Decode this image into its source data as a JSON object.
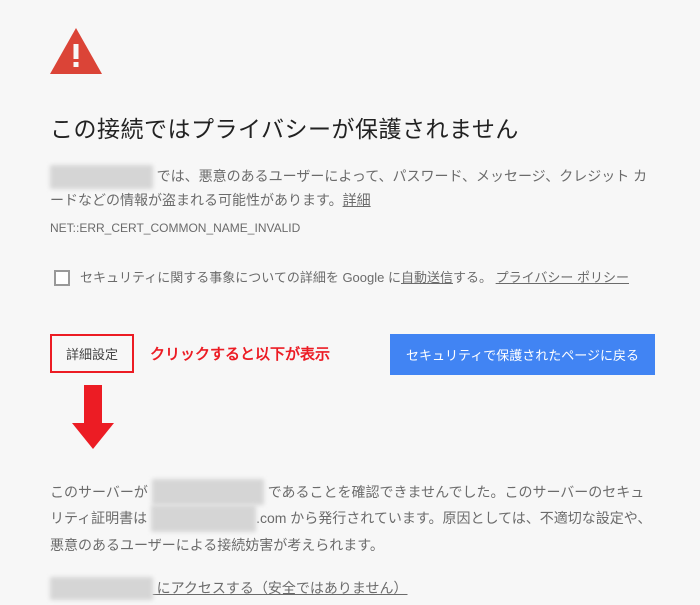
{
  "title": "この接続ではプライバシーが保護されません",
  "body": {
    "redacted1": "XXXXXXXXXXX",
    "text1": " では、悪意のあるユーザーによって、パスワード、メッセージ、クレジット カードなどの情報が盗まれる可能性があります。",
    "more_link": "詳細"
  },
  "error_code": "NET::ERR_CERT_COMMON_NAME_INVALID",
  "optin": {
    "text_before": "セキュリティに関する事象についての詳細を Google に",
    "auto_send": "自動送信",
    "text_after": "する。",
    "policy": "プライバシー ポリシー"
  },
  "buttons": {
    "advanced": "詳細設定",
    "back_safety": "セキュリティで保護されたページに戻る"
  },
  "annotation": "クリックすると以下が表示",
  "detail": {
    "t1": "このサーバーが ",
    "r1": "XXXXXXXXXXXX",
    "t2": " であることを確認できませんでした。このサーバーのセキュリティ証明書は ",
    "r2": "xxxxxxxxxxxxxxx",
    "t3": ".com から発行されています。原因としては、不適切な設定や、悪意のあるユーザーによる接続妨害が考えられます。"
  },
  "proceed": {
    "r": "XXXXXXXXXXX",
    "text": " にアクセスする（安全ではありません）"
  }
}
